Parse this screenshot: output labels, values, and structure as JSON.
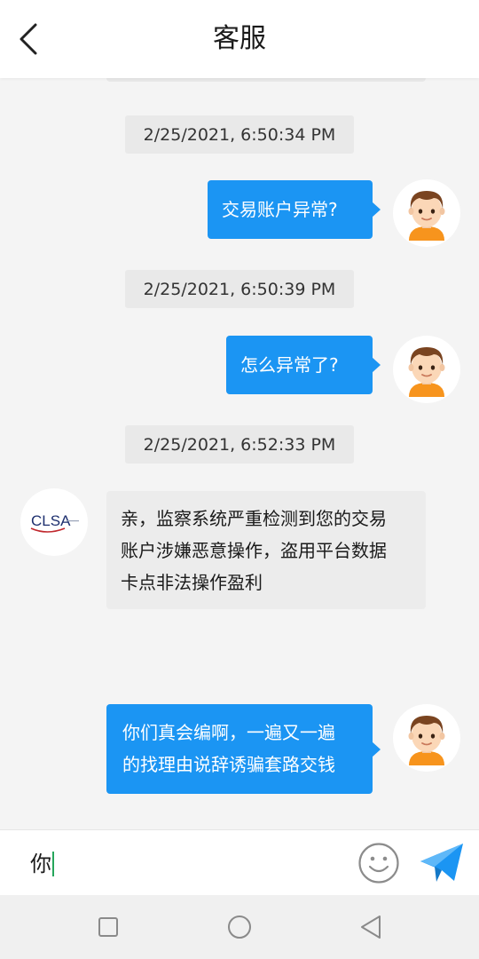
{
  "header": {
    "title": "客服",
    "back_icon": "chevron-left-icon"
  },
  "messages": [
    {
      "timestamp": "2/25/2021, 6:50:34 PM",
      "direction": "outgoing",
      "text": "交易账户异常?"
    },
    {
      "timestamp": "2/25/2021, 6:50:39 PM",
      "direction": "outgoing",
      "text": "怎么异常了?"
    },
    {
      "timestamp": "2/25/2021, 6:52:33 PM",
      "direction": "incoming",
      "text": "亲，监察系统严重检测到您的交易\n账户涉嫌恶意操作，盗用平台数据\n卡点非法操作盈利"
    },
    {
      "direction": "outgoing",
      "text": "你们真会编啊，一遍又一遍\n的找理由说辞诱骗套路交钱"
    }
  ],
  "support_avatar": {
    "logo_text": "CLSA"
  },
  "input": {
    "value": "你"
  },
  "icons": {
    "emoji": "smiley-face-icon",
    "send": "paper-plane-icon",
    "nav_recent": "square-icon",
    "nav_home": "circle-icon",
    "nav_back": "triangle-back-icon"
  },
  "colors": {
    "accent": "#1b95f3",
    "incoming_bubble": "#ececec",
    "timestamp_bg": "#e9e9e9",
    "background": "#f4f4f4"
  }
}
